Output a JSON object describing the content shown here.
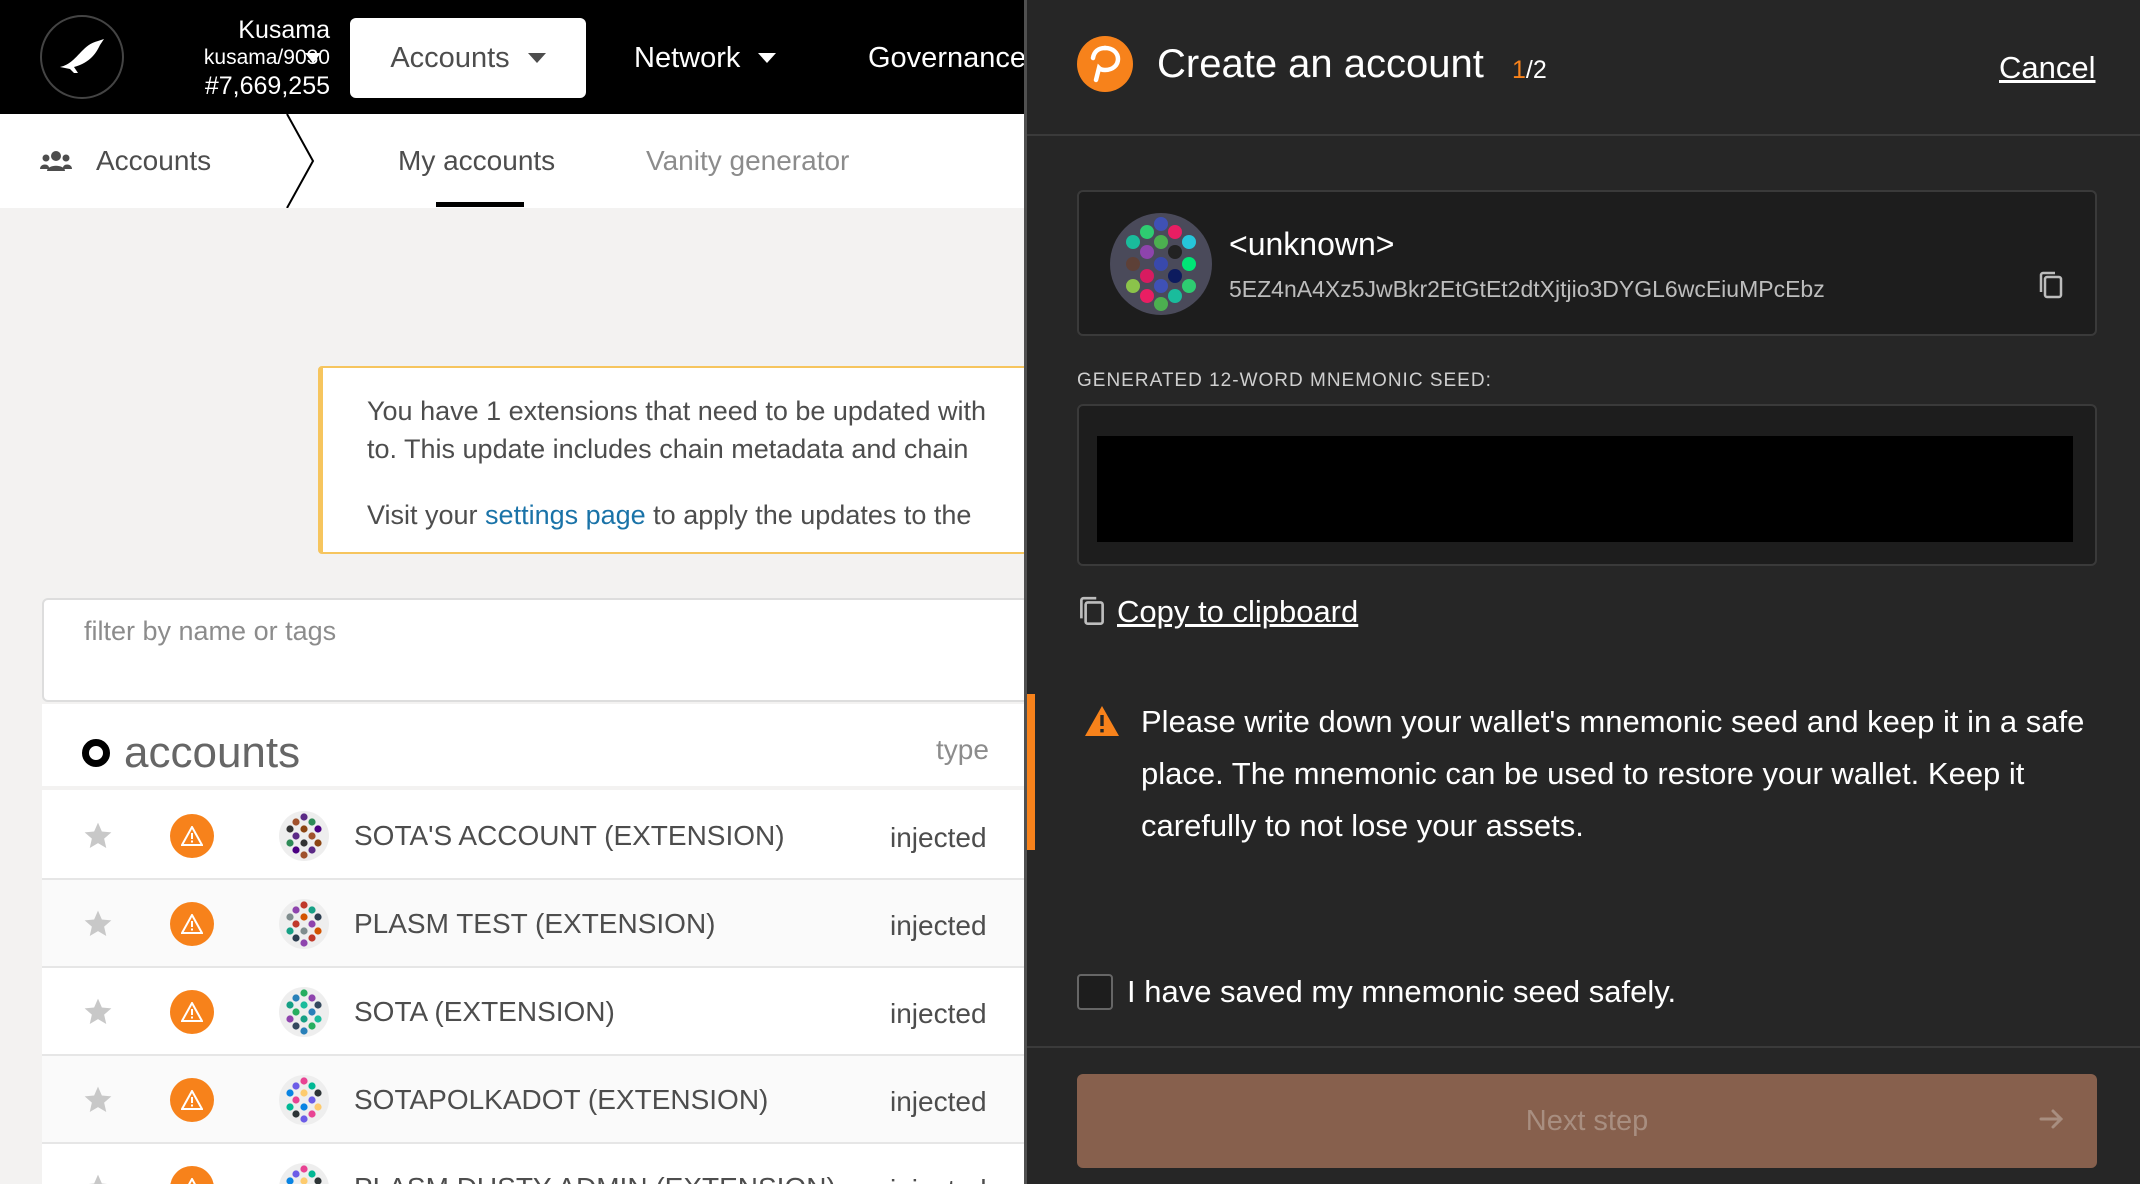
{
  "topbar": {
    "chain_name": "Kusama",
    "chain_spec": "kusama/9030",
    "block_number": "#7,669,255",
    "nav": {
      "accounts_label": "Accounts",
      "network_label": "Network",
      "governance_label": "Governance"
    }
  },
  "subnav": {
    "section_label": "Accounts",
    "tabs": [
      {
        "label": "My accounts",
        "active": true
      },
      {
        "label": "Vanity generator",
        "active": false
      }
    ]
  },
  "notice": {
    "line1": "You have 1 extensions that need to be updated with",
    "line2": "to. This update includes chain metadata and chain",
    "line3_prefix": "Visit your ",
    "line3_link": "settings page",
    "line3_suffix": " to apply the updates to the"
  },
  "filter": {
    "placeholder": "filter by name or tags"
  },
  "accounts_table": {
    "title": "accounts",
    "type_header": "type",
    "rows": [
      {
        "name": "SOTA'S ACCOUNT (EXTENSION)",
        "type": "injected"
      },
      {
        "name": "PLASM TEST (EXTENSION)",
        "type": "injected"
      },
      {
        "name": "SOTA (EXTENSION)",
        "type": "injected"
      },
      {
        "name": "SOTAPOLKADOT (EXTENSION)",
        "type": "injected"
      },
      {
        "name": "PLASM DUSTY ADMIN (EXTENSION)",
        "type": "injected"
      }
    ]
  },
  "drawer": {
    "title": "Create an account",
    "step_current": "1",
    "step_total": "/2",
    "cancel_label": "Cancel",
    "account": {
      "name": "<unknown>",
      "address": "5EZ4nA4Xz5JwBkr2EtGtEt2dtXjtjio3DYGL6wcEiuMPcEbz"
    },
    "seed_label": "GENERATED 12-WORD MNEMONIC SEED:",
    "copy_label": "Copy to clipboard",
    "warning": "Please write down your wallet's mnemonic seed and keep it in a safe place. The mnemonic can be used to restore your wallet. Keep it carefully to not lose your assets.",
    "confirm_label": "I have saved my mnemonic seed safely.",
    "next_label": "Next step"
  },
  "colors": {
    "accent": "#f7821b",
    "drawer_bg": "#262626",
    "next_button": "#87604d",
    "notice_border": "#f6c55e",
    "link": "#1a73a8"
  },
  "icons": [
    "kusama-bird-icon",
    "users-icon",
    "star-icon",
    "warning-icon",
    "identicon",
    "copy-icon",
    "polkadot-logo-icon",
    "arrow-right-icon"
  ]
}
